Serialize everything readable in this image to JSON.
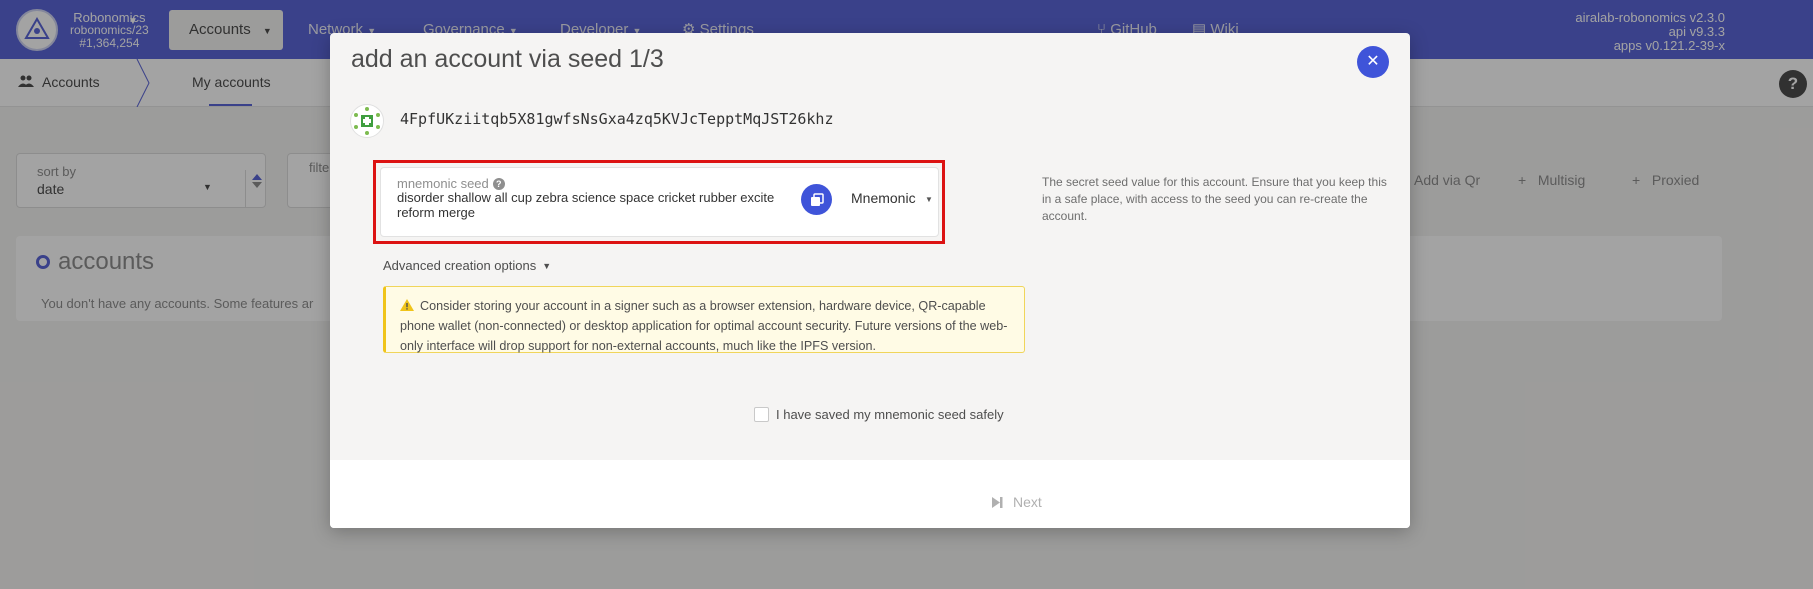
{
  "chain": {
    "name": "Robonomics",
    "spec": "robonomics/23",
    "block": "#1,364,254"
  },
  "nav": {
    "accounts": "Accounts",
    "network": "Network",
    "governance": "Governance",
    "developer": "Developer",
    "settings": "Settings",
    "github": "GitHub",
    "wiki": "Wiki"
  },
  "versions": {
    "app": "airalab-robonomics v2.3.0",
    "api": "api v9.3.3",
    "apps": "apps v0.121.2-39-x"
  },
  "subnav": {
    "section": "Accounts",
    "tab": "My accounts"
  },
  "page": {
    "sort_label": "sort by",
    "sort_value": "date",
    "filter_label": "filte",
    "add_via_qr": "Add via Qr",
    "multisig": "Multisig",
    "proxied": "Proxied",
    "accounts_title": "accounts",
    "accounts_message": "You don't have any accounts. Some features ar"
  },
  "modal": {
    "title": "add an account via seed 1/3",
    "address": "4FpfUKziitqb5X81gwfsNsGxa4zq5KVJcTepptMqJST26khz",
    "seed_label": "mnemonic seed",
    "seed_value": "disorder shallow all cup zebra science space cricket rubber excite reform merge",
    "seed_type": "Mnemonic",
    "help_text": "The secret seed value for this account. Ensure that you keep this in a safe place, with access to the seed you can re-create the account.",
    "advanced_label": "Advanced creation options",
    "warning": "Consider storing your account in a signer such as a browser extension, hardware device, QR-capable phone wallet (non-connected) or desktop application for optimal account security. Future versions of the web-only interface will drop support for non-external accounts, much like the IPFS version.",
    "saved_label": "I have saved my mnemonic seed safely",
    "next_label": "Next"
  },
  "colors": {
    "nav_bg": "#5b66d8",
    "accent": "#3f54d9",
    "highlight": "#dc1212",
    "warning_border": "#f0c419"
  }
}
